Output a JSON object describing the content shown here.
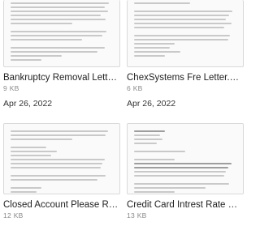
{
  "files": [
    {
      "name": "Bankruptcy Removal Letter.d...",
      "size": "9 KB",
      "date": "Apr 26, 2022"
    },
    {
      "name": "ChexSystems Fre Letter.odt",
      "size": "6 KB",
      "date": "Apr 26, 2022"
    },
    {
      "name": "Closed Account Please Rem...",
      "size": "12 KB",
      "date": ""
    },
    {
      "name": "Credit Card Intrest Rate Reje...",
      "size": "13 KB",
      "date": ""
    }
  ]
}
